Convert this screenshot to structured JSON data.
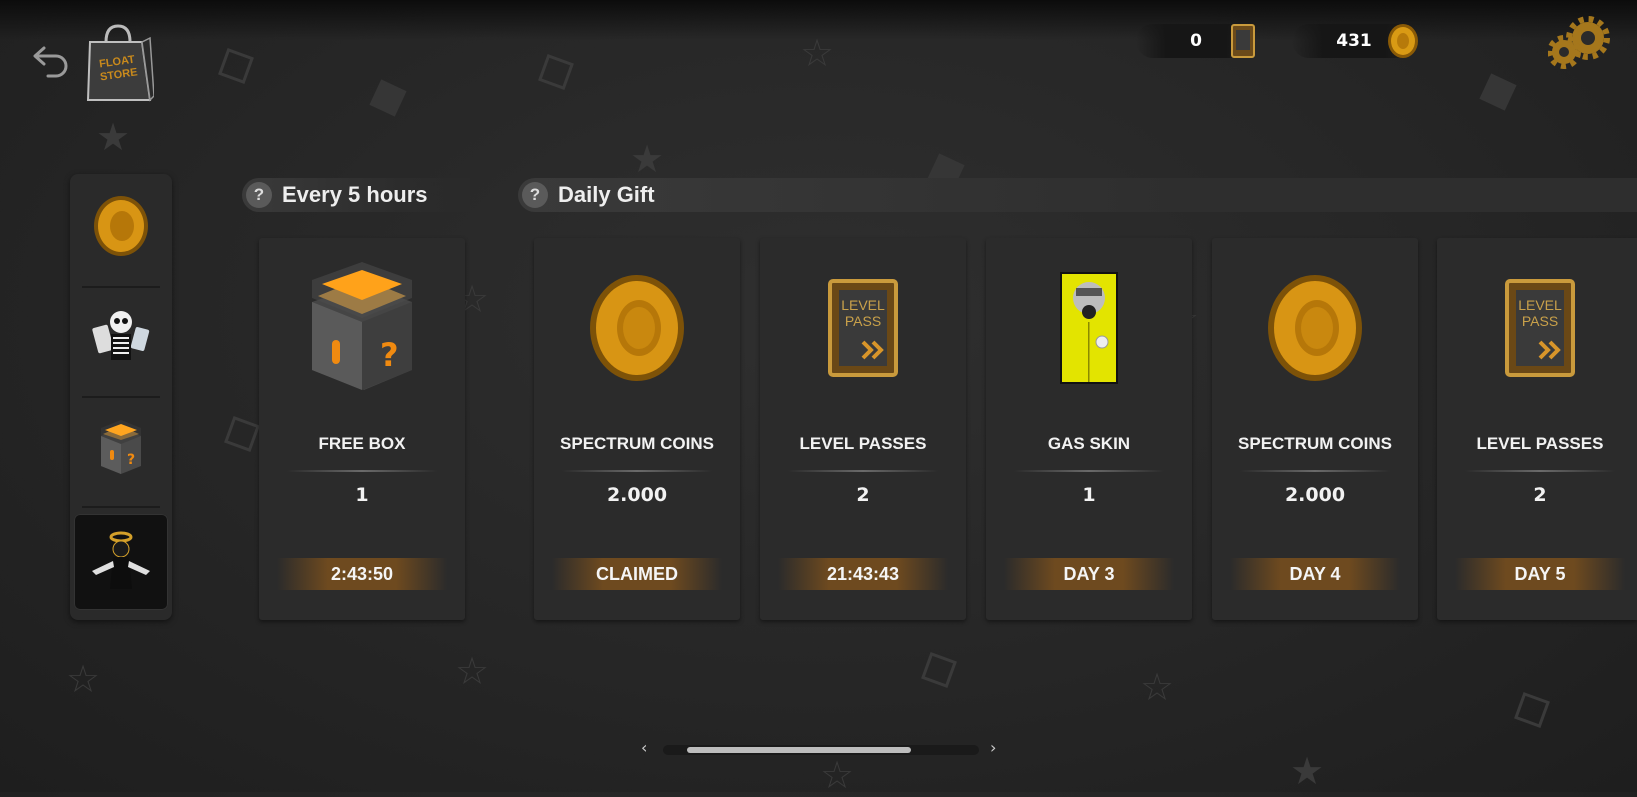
{
  "currency": {
    "level_passes": {
      "value": "0",
      "icon": "level-pass-icon"
    },
    "coins": {
      "value": "431",
      "icon": "coin-icon"
    }
  },
  "logo": {
    "text_line1": "FLOAT",
    "text_line2": "STORE"
  },
  "sidebar": [
    {
      "id": "coins",
      "icon": "coin-icon"
    },
    {
      "id": "skins",
      "icon": "skeleton-character-icon"
    },
    {
      "id": "boxes",
      "icon": "mystery-box-icon"
    },
    {
      "id": "rewards",
      "icon": "angel-character-icon",
      "active": true
    }
  ],
  "sections": {
    "every5": {
      "label": "Every 5 hours",
      "help": "?"
    },
    "daily": {
      "label": "Daily Gift",
      "help": "?"
    }
  },
  "cards": [
    {
      "title": "FREE BOX",
      "amount": "1",
      "status": "2:43:50",
      "icon": "mystery-box-icon"
    },
    {
      "title": "SPECTRUM COINS",
      "amount": "2.000",
      "status": "CLAIMED",
      "icon": "coin-icon"
    },
    {
      "title": "LEVEL PASSES",
      "amount": "2",
      "status": "21:43:43",
      "icon": "level-pass-icon"
    },
    {
      "title": "GAS SKIN",
      "amount": "1",
      "status": "DAY 3",
      "icon": "gas-skin-icon"
    },
    {
      "title": "SPECTRUM COINS",
      "amount": "2.000",
      "status": "DAY 4",
      "icon": "coin-icon"
    },
    {
      "title": "LEVEL PASSES",
      "amount": "2",
      "status": "DAY 5",
      "icon": "level-pass-icon"
    }
  ],
  "level_pass_label": {
    "line1": "LEVEL",
    "line2": "PASS"
  },
  "scrollbar": {
    "left": "‹",
    "right": "›"
  },
  "colors": {
    "accent_gold": "#c9911a",
    "status_bar": "#6e4a1f",
    "background": "#262626"
  }
}
